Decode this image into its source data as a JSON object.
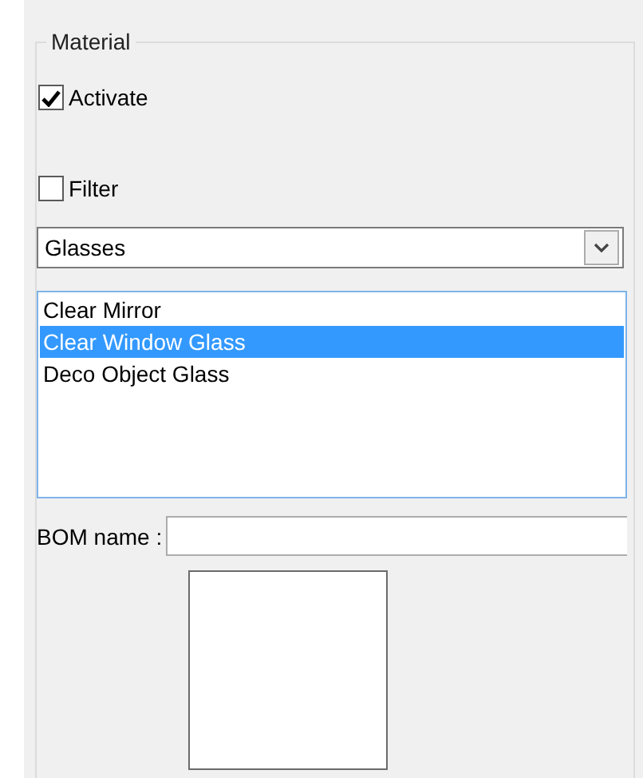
{
  "group": {
    "title": "Material"
  },
  "checkboxes": [
    {
      "label": "Activate",
      "checked": true
    },
    {
      "label": "Filter",
      "checked": false
    }
  ],
  "dropdown": {
    "value": "Glasses"
  },
  "list": [
    {
      "label": "Clear Mirror",
      "selected": false
    },
    {
      "label": "Clear Window Glass",
      "selected": true
    },
    {
      "label": "Deco Object Glass",
      "selected": false
    }
  ],
  "bom_name": {
    "label": "BOM name :"
  }
}
